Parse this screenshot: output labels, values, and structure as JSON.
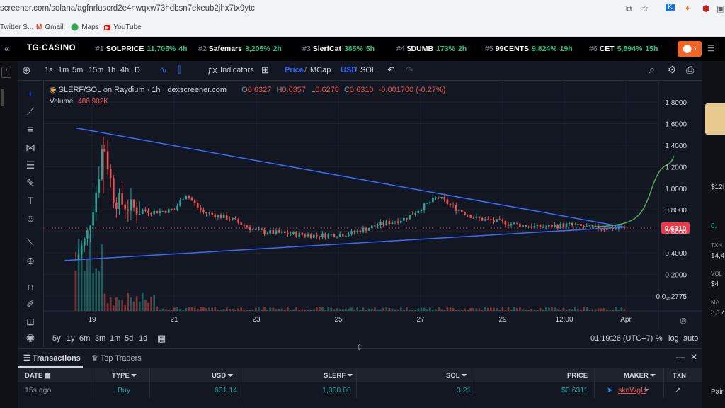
{
  "browser": {
    "url": "screener.com/solana/agfnrluscrd2e4nwqxw73hdbsn7ekeub2jhx7tx9ytc",
    "bookmarks": [
      "Twitter S...",
      "Gmail",
      "Maps",
      "YouTube"
    ]
  },
  "trending": {
    "brand": "TG·CASINO",
    "items": [
      {
        "rank": "#1",
        "name": "SOLPRICE",
        "pct": "11,705%",
        "time": "4h"
      },
      {
        "rank": "#2",
        "name": "Safemars",
        "pct": "3,205%",
        "time": "2h"
      },
      {
        "rank": "#3",
        "name": "SlerfCat",
        "pct": "385%",
        "time": "5h"
      },
      {
        "rank": "#4",
        "name": "$DUMB",
        "pct": "173%",
        "time": "2h"
      },
      {
        "rank": "#5",
        "name": "99CENTS",
        "pct": "9,824%",
        "time": "19h"
      },
      {
        "rank": "#6",
        "name": "CET",
        "pct": "5,894%",
        "time": "15h"
      }
    ]
  },
  "toolbar": {
    "timeframes": [
      "1s",
      "1m",
      "5m",
      "15m",
      "1h",
      "4h",
      "D"
    ],
    "indicators_label": "Indicators",
    "price_label": "Price",
    "mcap_label": "MCap",
    "usd_label": "USD",
    "sol_label": "SOL"
  },
  "chart": {
    "title": "SLERF/SOL on Raydium · 1h · dexscreener.com",
    "ohlc": {
      "o": "0.6327",
      "h": "0.6357",
      "l": "0.6278",
      "c": "0.6310",
      "chg": "-0.001700 (-0.27%)"
    },
    "volume_label": "Volume",
    "volume_value": "486.902K",
    "current_price": "0.6310",
    "y_ticks": [
      "1.8000",
      "1.6000",
      "1.4000",
      "1.2000",
      "1.0000",
      "0.8000",
      "0.6000",
      "0.4000",
      "0.2000",
      "0.0₁₅2775"
    ],
    "x_ticks": [
      "19",
      "21",
      "23",
      "25",
      "27",
      "29",
      "12:00",
      "Apr"
    ]
  },
  "chart_data": {
    "type": "candlestick",
    "title": "SLERF/SOL on Raydium · 1h · dexscreener.com",
    "ylim": [
      0,
      1.9
    ],
    "y_ticks": [
      1.8,
      1.6,
      1.4,
      1.2,
      1.0,
      0.8,
      0.6,
      0.4,
      0.2
    ],
    "x_tick_labels": [
      "19",
      "21",
      "23",
      "25",
      "27",
      "29",
      "12:00",
      "Apr"
    ],
    "price_path": [
      [
        0,
        0.34
      ],
      [
        0.02,
        0.55
      ],
      [
        0.04,
        1.05
      ],
      [
        0.05,
        1.45
      ],
      [
        0.07,
        0.9
      ],
      [
        0.1,
        0.82
      ],
      [
        0.14,
        0.78
      ],
      [
        0.18,
        0.8
      ],
      [
        0.2,
        0.95
      ],
      [
        0.23,
        0.78
      ],
      [
        0.28,
        0.72
      ],
      [
        0.33,
        0.6
      ],
      [
        0.38,
        0.58
      ],
      [
        0.44,
        0.56
      ],
      [
        0.5,
        0.58
      ],
      [
        0.55,
        0.66
      ],
      [
        0.6,
        0.72
      ],
      [
        0.63,
        0.82
      ],
      [
        0.66,
        0.92
      ],
      [
        0.69,
        0.82
      ],
      [
        0.73,
        0.72
      ],
      [
        0.78,
        0.68
      ],
      [
        0.84,
        0.64
      ],
      [
        0.9,
        0.66
      ],
      [
        0.94,
        0.63
      ],
      [
        1.0,
        0.631
      ]
    ],
    "upper_trendline": [
      [
        0.0,
        1.56
      ],
      [
        1.0,
        0.64
      ]
    ],
    "lower_trendline": [
      [
        -0.02,
        0.33
      ],
      [
        1.0,
        0.64
      ]
    ],
    "projection": [
      [
        0.94,
        0.64
      ],
      [
        1.02,
        0.66
      ],
      [
        1.05,
        1.0
      ],
      [
        1.09,
        1.3
      ]
    ],
    "current_price": 0.631,
    "volume": "486.902K"
  },
  "timebar": {
    "ranges": [
      "5y",
      "1y",
      "6m",
      "3m",
      "1m",
      "5d",
      "1d"
    ],
    "clock": "01:19:26 (UTC+7)",
    "pct_label": "%",
    "log_label": "log",
    "auto_label": "auto"
  },
  "transactions": {
    "tab_active": "Transactions",
    "tab_other": "Top Traders",
    "headers": [
      "DATE",
      "TYPE",
      "USD",
      "SLERF",
      "SOL",
      "PRICE",
      "MAKER",
      "TXN"
    ],
    "row": {
      "date": "15s ago",
      "type": "Buy",
      "usd": "631.14",
      "slerf": "1,000.00",
      "sol": "3.21",
      "price": "$0.6311",
      "maker": "sknWgU"
    }
  },
  "right_panel": {
    "lines": [
      "$12!",
      "0.",
      "TXN",
      "14,4",
      "VOL",
      "$4",
      "MA",
      "3,17",
      "Pair"
    ]
  },
  "colors": {
    "up": "#26a69a",
    "down": "#ef5350",
    "trend": "#3d6bff",
    "projection": "#4caf50",
    "price_tag": "#f23645"
  }
}
